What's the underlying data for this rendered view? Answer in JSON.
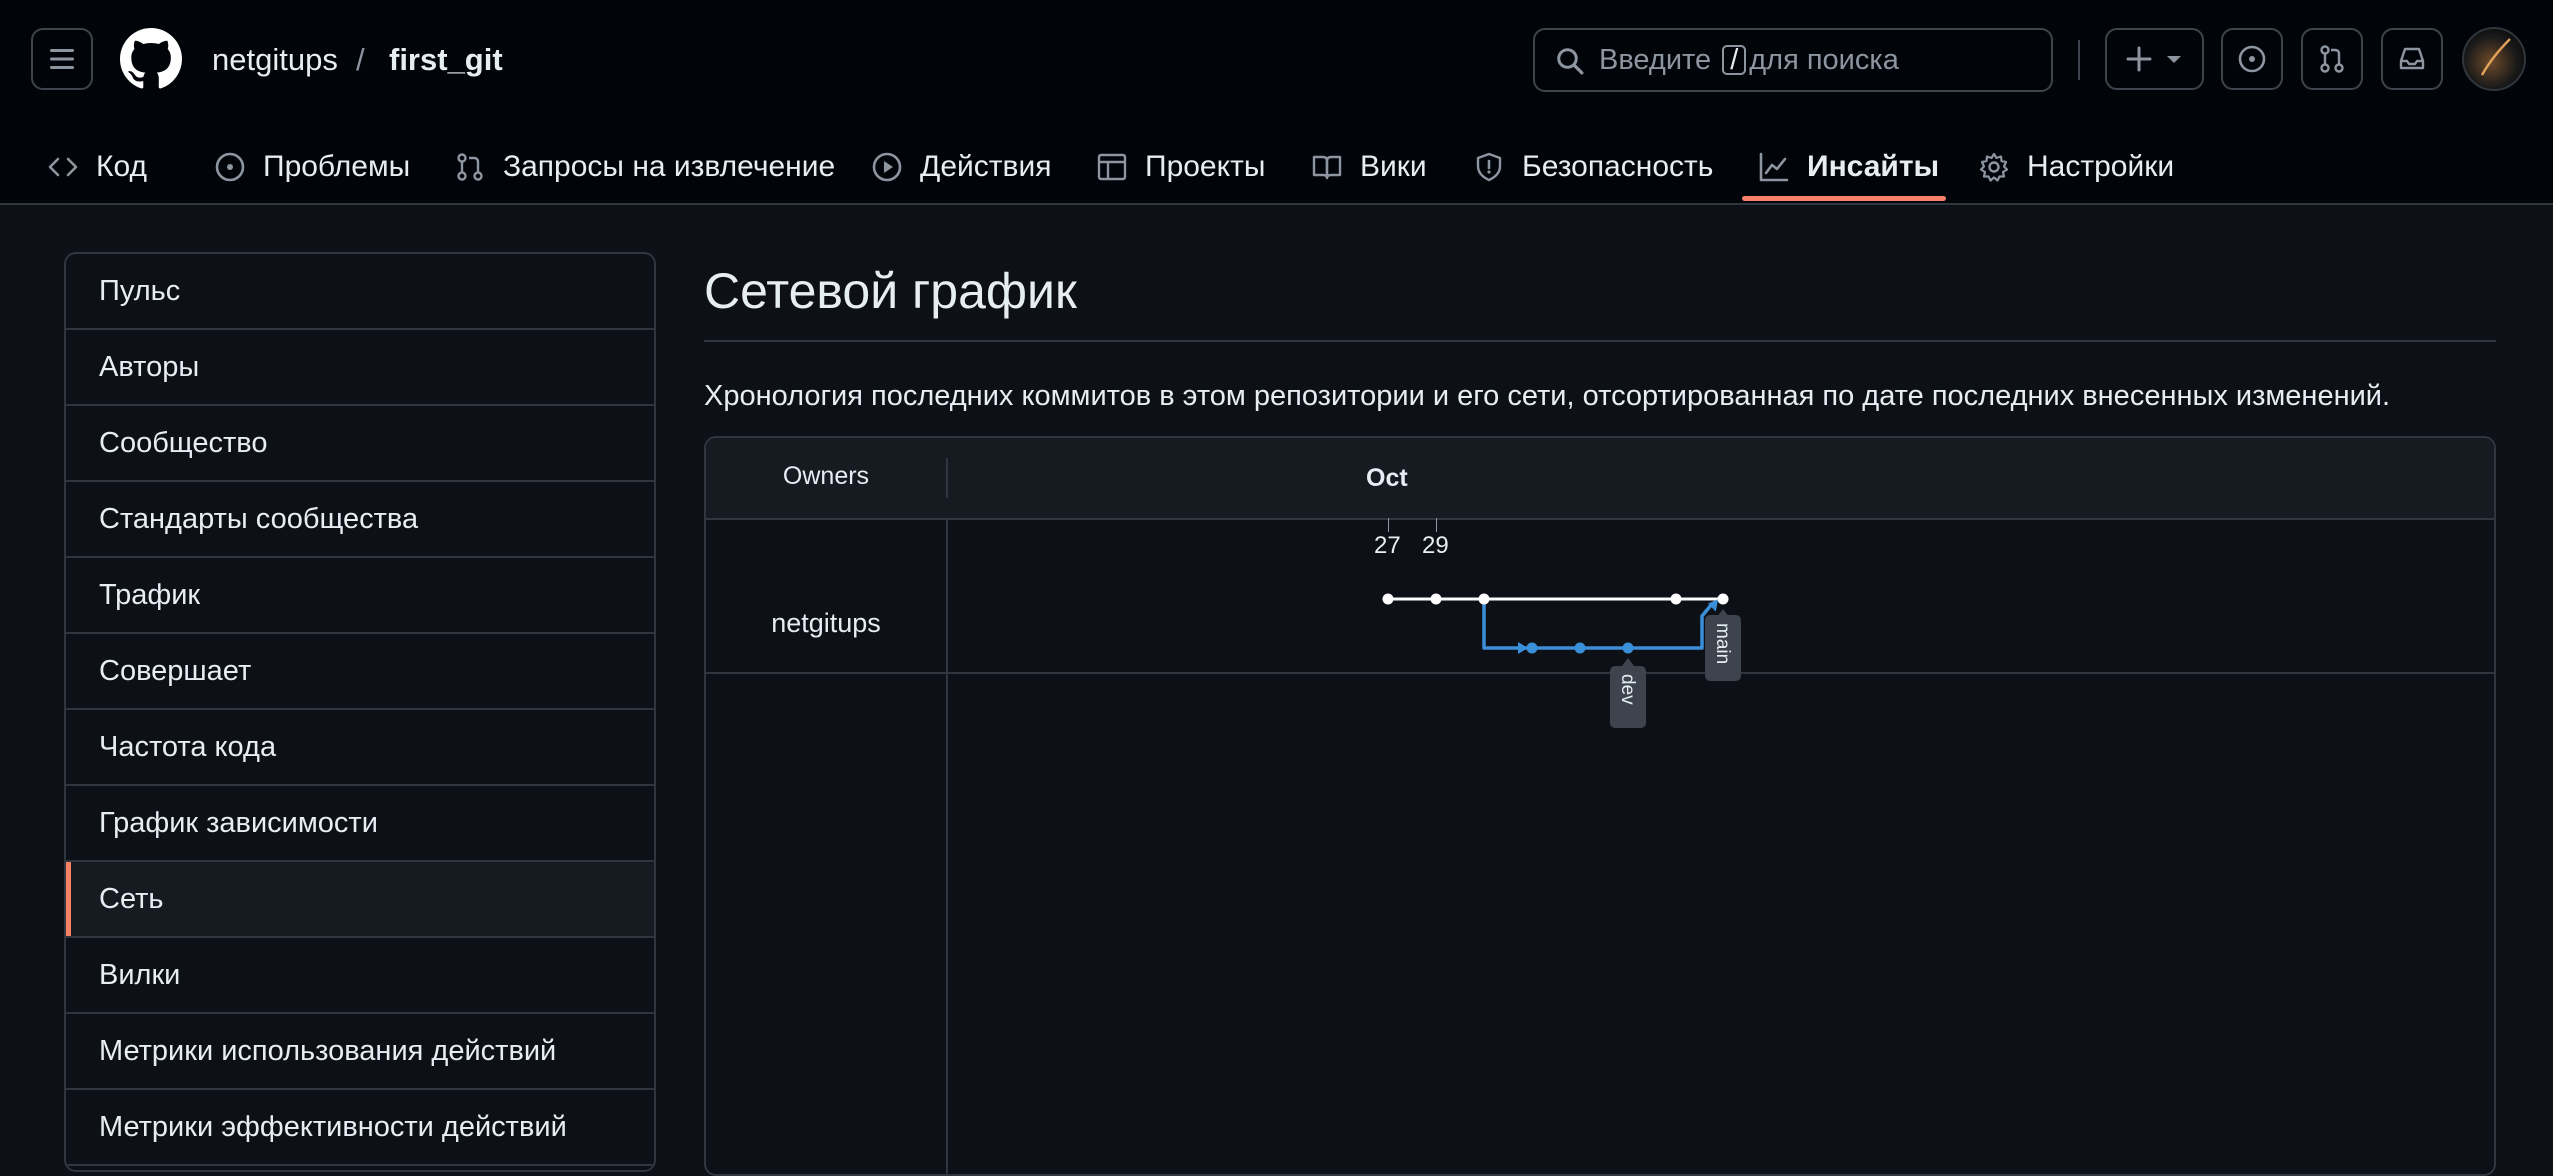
{
  "header": {
    "owner": "netgitups",
    "separator": "/",
    "repo": "first_git",
    "search_prefix": "Введите",
    "search_key": "/",
    "search_suffix": "для поиска"
  },
  "tabs": [
    {
      "label": "Код",
      "icon": "code-icon"
    },
    {
      "label": "Проблемы",
      "icon": "issue-opened-icon"
    },
    {
      "label": "Запросы на извлечение",
      "icon": "git-pull-request-icon"
    },
    {
      "label": "Действия",
      "icon": "play-icon"
    },
    {
      "label": "Проекты",
      "icon": "table-icon"
    },
    {
      "label": "Вики",
      "icon": "book-icon"
    },
    {
      "label": "Безопасность",
      "icon": "shield-icon"
    },
    {
      "label": "Инсайты",
      "icon": "graph-icon",
      "active": true
    },
    {
      "label": "Настройки",
      "icon": "gear-icon"
    }
  ],
  "sidebar": {
    "items": [
      "Пульс",
      "Авторы",
      "Сообщество",
      "Стандарты сообщества",
      "Трафик",
      "Совершает",
      "Частота кода",
      "График зависимости",
      "Сеть",
      "Вилки",
      "Метрики использования действий",
      "Метрики эффективности действий"
    ],
    "selected": "Сеть"
  },
  "main": {
    "title": "Сетевой график",
    "description": "Хронология последних коммитов в этом репозитории и его сети, отсортированная по дате последних внесенных изменений."
  },
  "network": {
    "owners_header": "Owners",
    "month": "Oct",
    "days": [
      "27",
      "29"
    ],
    "owner": "netgitups",
    "branches": [
      {
        "name": "main",
        "color": "#ffffff"
      },
      {
        "name": "dev",
        "color": "#3b8ed8"
      }
    ],
    "colors": {
      "accent": "#f78166",
      "background": "#0d1117",
      "header": "#010409",
      "border": "#30363d"
    }
  }
}
